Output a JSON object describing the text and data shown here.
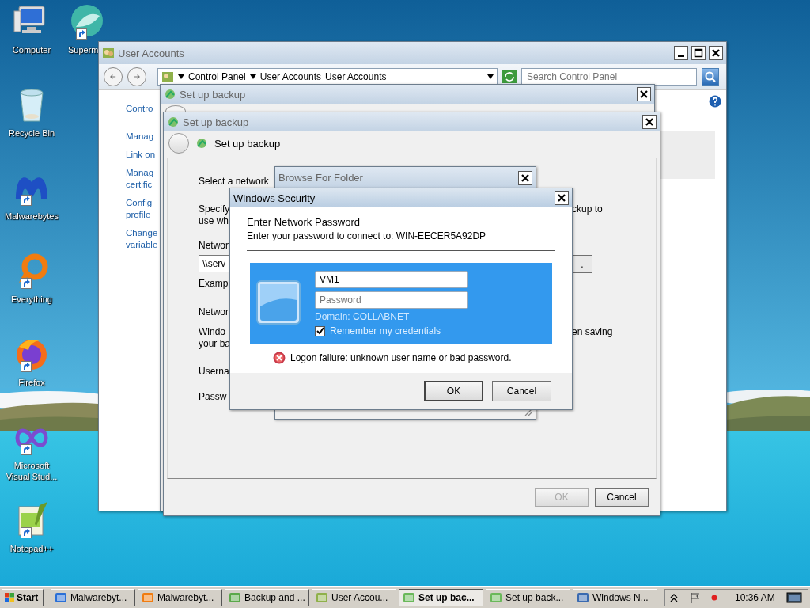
{
  "desktop": {
    "columns": [
      [
        {
          "label": "Computer",
          "shortcut": false
        },
        {
          "label": "Recycle Bin",
          "shortcut": false
        },
        {
          "label": "Malwarebytes",
          "shortcut": true
        },
        {
          "label": "Everything",
          "shortcut": true
        },
        {
          "label": "Firefox",
          "shortcut": true
        },
        {
          "label": "Microsoft\nVisual Stud...",
          "shortcut": true
        },
        {
          "label": "Notepad++",
          "shortcut": true
        }
      ],
      [
        {
          "label": "Superm",
          "shortcut": true
        }
      ]
    ]
  },
  "user_accounts_window": {
    "title": "User Accounts",
    "breadcrumb": [
      "Control Panel",
      "User Accounts",
      "User Accounts"
    ],
    "search": {
      "placeholder": "Search Control Panel"
    },
    "sidebar_links": [
      "Contro",
      "Manag",
      "Link on",
      "Manag\ncertific",
      "Config\nprofile",
      "Change\nvariable"
    ]
  },
  "backup_window_behind": {
    "title": "Set up backup"
  },
  "backup_window": {
    "title": "Set up backup",
    "heading": "Set up backup",
    "content": [
      {
        "kind": "text",
        "left": "Select a network"
      },
      {
        "kind": "text",
        "left": "Specify\nuse wh",
        "right": "ckup to"
      },
      {
        "kind": "text",
        "left": "Networ"
      },
      {
        "kind": "field",
        "value": "\\\\serv",
        "button": "."
      },
      {
        "kind": "text",
        "left": "Examp"
      },
      {
        "kind": "text",
        "left": "Networ"
      },
      {
        "kind": "text",
        "left": "Windo\nyour ba",
        "right": "en saving"
      },
      {
        "kind": "text",
        "left": "Userna"
      },
      {
        "kind": "text",
        "left": "Passw"
      }
    ],
    "buttons": [
      {
        "label": "OK",
        "disabled": true
      },
      {
        "label": "Cancel",
        "disabled": false
      }
    ]
  },
  "browse_dialog": {
    "title": "Browse For Folder"
  },
  "security_dialog": {
    "title": "Windows Security",
    "heading": "Enter Network Password",
    "subtitle": "Enter your password to connect to: WIN-EECER5A92DP",
    "username": {
      "value": "VM1"
    },
    "password": {
      "placeholder": "Password"
    },
    "domain": "Domain: COLLABNET",
    "remember": {
      "label": "Remember my credentials",
      "checked": true
    },
    "error": "Logon failure: unknown user name or bad password.",
    "buttons": [
      {
        "label": "OK",
        "default": true
      },
      {
        "label": "Cancel",
        "default": false
      }
    ]
  },
  "taskbar": {
    "start": "Start",
    "items": [
      {
        "label": "Malwarebyt...",
        "selected": false
      },
      {
        "label": "Malwarebyt...",
        "selected": false
      },
      {
        "label": "Backup and ...",
        "selected": false
      },
      {
        "label": "User Accou...",
        "selected": false
      },
      {
        "label": "Set up bac...",
        "selected": true
      },
      {
        "label": "Set up back...",
        "selected": false
      },
      {
        "label": "Windows N...",
        "selected": false
      }
    ],
    "time": "10:36 AM"
  }
}
